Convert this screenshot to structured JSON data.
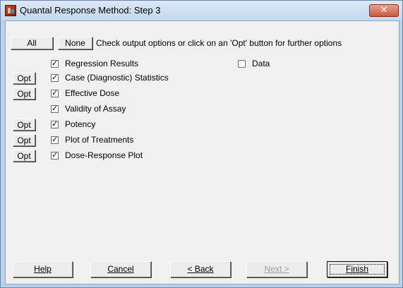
{
  "window": {
    "title": "Quantal Response Method: Step 3",
    "close_glyph": "✕",
    "app_icon": "app-icon"
  },
  "toolbar": {
    "all_label": "All",
    "none_label": "None",
    "hint": "Check output options or click on an 'Opt' button for further options"
  },
  "options": [
    {
      "label": "Regression Results",
      "checked": true,
      "has_opt": false
    },
    {
      "label": "Case (Diagnostic) Statistics",
      "checked": true,
      "has_opt": true
    },
    {
      "label": "Effective Dose",
      "checked": true,
      "has_opt": true
    },
    {
      "label": "Validity of Assay",
      "checked": true,
      "has_opt": false
    },
    {
      "label": "Potency",
      "checked": true,
      "has_opt": true
    },
    {
      "label": "Plot of Treatments",
      "checked": true,
      "has_opt": true
    },
    {
      "label": "Dose-Response Plot",
      "checked": true,
      "has_opt": true
    }
  ],
  "data_option": {
    "label": "Data",
    "checked": false
  },
  "opt_label": "Opt",
  "footer": {
    "help_label": "Help",
    "cancel_label": "Cancel",
    "back_label": "< Back",
    "next_label": "Next >",
    "finish_label": "Finish"
  }
}
